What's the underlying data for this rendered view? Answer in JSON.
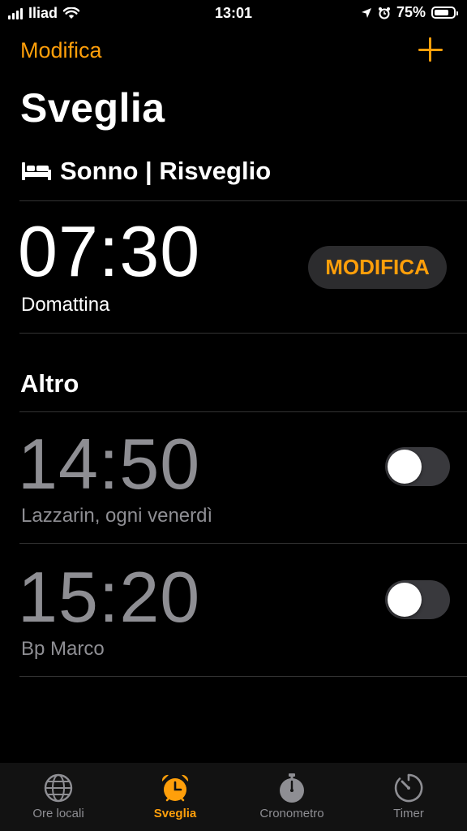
{
  "status": {
    "carrier": "Iliad",
    "time": "13:01",
    "battery": "75%",
    "battery_level": 0.75,
    "icons": [
      "signal-icon",
      "wifi-icon",
      "location-icon",
      "alarm-icon",
      "battery-icon"
    ]
  },
  "nav": {
    "edit_label": "Modifica",
    "add_icon": "plus-icon"
  },
  "page_title": "Sveglia",
  "sleep": {
    "header": "Sonno | Risveglio",
    "icon": "bed-icon",
    "time": "07:30",
    "subtitle": "Domattina",
    "button_label": "MODIFICA"
  },
  "other": {
    "header": "Altro",
    "alarms": [
      {
        "time": "14:50",
        "label": "Lazzarin, ogni venerdì",
        "enabled": false
      },
      {
        "time": "15:20",
        "label": "Bp Marco",
        "enabled": false
      }
    ]
  },
  "tabs": [
    {
      "label": "Ore locali",
      "icon": "globe-icon",
      "active": false
    },
    {
      "label": "Sveglia",
      "icon": "alarm-clock-icon",
      "active": true
    },
    {
      "label": "Cronometro",
      "icon": "stopwatch-icon",
      "active": false
    },
    {
      "label": "Timer",
      "icon": "timer-icon",
      "active": false
    }
  ],
  "colors": {
    "accent": "#ff9f0a",
    "background": "#000000",
    "inactive_text": "#8e8e93",
    "pill_bg": "#2c2c2e"
  }
}
